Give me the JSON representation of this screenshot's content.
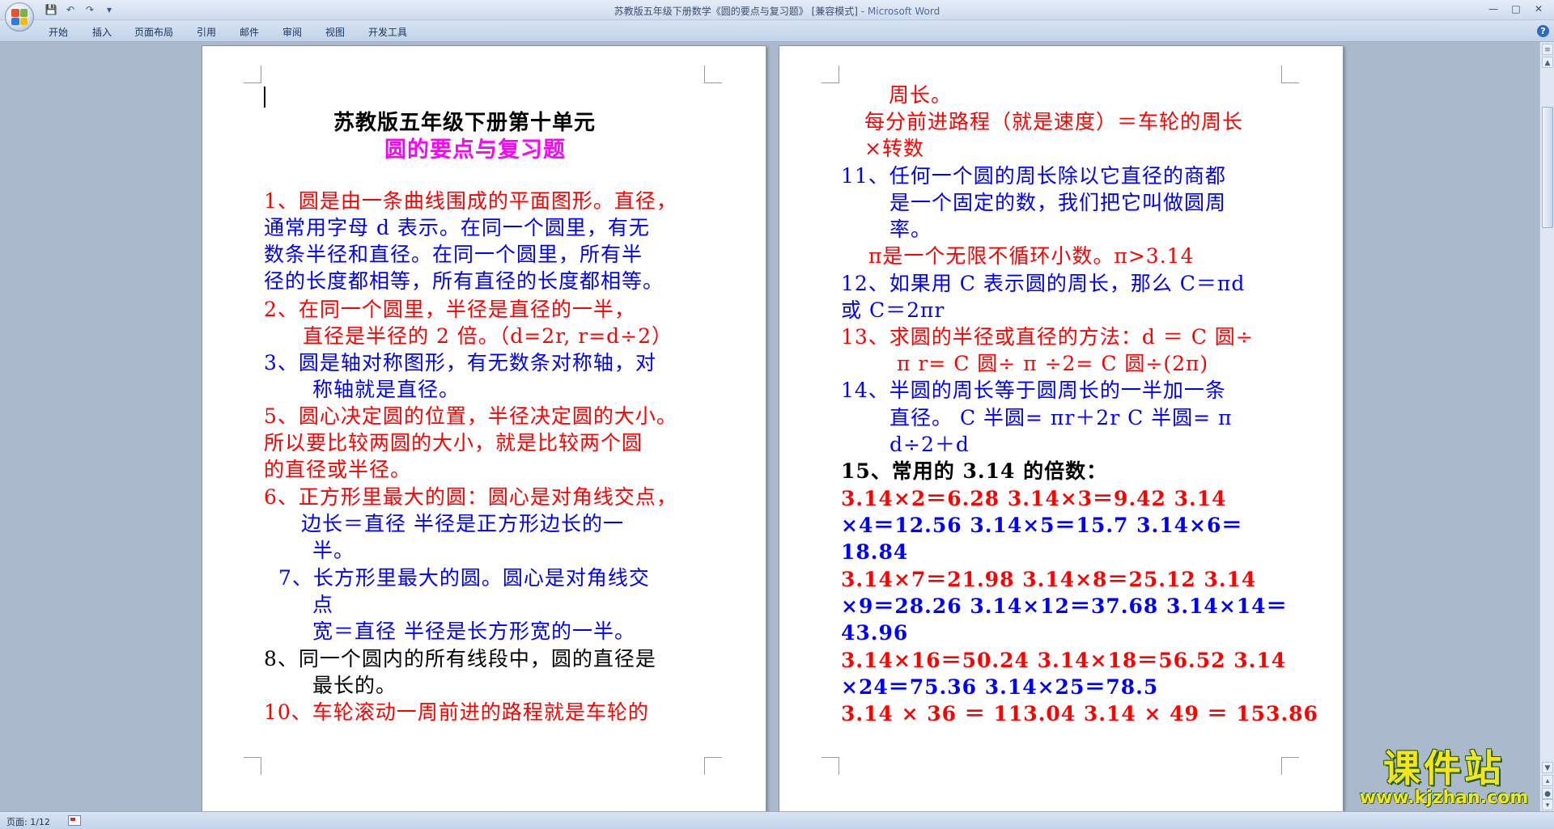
{
  "window": {
    "title": "苏教版五年级下册数学《圆的要点与复习题》 [兼容模式]",
    "app_name": " - Microsoft Word",
    "qat": [
      "💾",
      "↶",
      "↷",
      "▾"
    ],
    "controls": [
      "—",
      "□",
      "✕"
    ]
  },
  "ribbon": {
    "tabs": [
      "开始",
      "插入",
      "页面布局",
      "引用",
      "邮件",
      "审阅",
      "视图",
      "开发工具"
    ],
    "help": "?"
  },
  "status": {
    "page": "页面: 1/12"
  },
  "watermark": {
    "top": "课件站",
    "bottom": "www.kjzhan.com"
  },
  "left_page": [
    {
      "text": "苏教版五年级下册第十单元",
      "color": "black",
      "bold": true
    },
    {
      "text": "圆的要点与复习题",
      "color": "magenta",
      "bold": true
    },
    {
      "text": "1、圆是由一条曲线围成的平面图形。直径，",
      "color": "red"
    },
    {
      "text": "通常用字母 d 表示。在同一个圆里，有无",
      "color": "blue"
    },
    {
      "text": "数条半径和直径。在同一个圆里，所有半",
      "color": "blue"
    },
    {
      "text": "径的长度都相等，所有直径的长度都相等。",
      "color": "blue"
    },
    {
      "text": "2、在同一个圆里，半径是直径的一半，",
      "color": "red"
    },
    {
      "text": "直径是半径的 2 倍。（d=2r,    r=d÷2）",
      "color": "red"
    },
    {
      "text": "3、圆是轴对称图形，有无数条对称轴，对",
      "color": "blue"
    },
    {
      "text": "称轴就是直径。",
      "color": "blue"
    },
    {
      "text": "5、圆心决定圆的位置，半径决定圆的大小。",
      "color": "red"
    },
    {
      "text": "所以要比较两圆的大小，就是比较两个圆",
      "color": "red"
    },
    {
      "text": "的直径或半径。",
      "color": "red"
    },
    {
      "text": "6、正方形里最大的圆：圆心是对角线交点，",
      "color": "red"
    },
    {
      "text": "边长＝直径  半径是正方形边长的一",
      "color": "blue"
    },
    {
      "text": "半。",
      "color": "blue"
    },
    {
      "text": "7、长方形里最大的圆。圆心是对角线交",
      "color": "blue"
    },
    {
      "text": "点",
      "color": "blue"
    },
    {
      "text": "宽＝直径   半径是长方形宽的一半。",
      "color": "blue"
    },
    {
      "text": "8、同一个圆内的所有线段中，圆的直径是",
      "color": "black"
    },
    {
      "text": "最长的。",
      "color": "black"
    },
    {
      "text": "10、车轮滚动一周前进的路程就是车轮的",
      "color": "red"
    }
  ],
  "right_page": [
    {
      "text": "周长。",
      "color": "red"
    },
    {
      "text": "每分前进路程（就是速度）＝车轮的周长",
      "color": "red"
    },
    {
      "text": "×转数",
      "color": "red"
    },
    {
      "text": "11、任何一个圆的周长除以它直径的商都",
      "color": "blue"
    },
    {
      "text": "是一个固定的数，我们把它叫做圆周",
      "color": "blue"
    },
    {
      "text": "率。",
      "color": "blue"
    },
    {
      "text": "π是一个无限不循环小数。π>3.14",
      "color": "red"
    },
    {
      "text": "12、如果用 C 表示圆的周长，那么 C＝πd",
      "color": "blue"
    },
    {
      "text": "或 C＝2πr",
      "color": "blue"
    },
    {
      "text": "13、求圆的半径或直径的方法：d ＝ C 圆÷",
      "color": "red"
    },
    {
      "text": "π          r= C 圆÷  π ÷2= C 圆÷(2π)",
      "color": "red"
    },
    {
      "text": "14、半圆的周长等于圆周长的一半加一条",
      "color": "blue"
    },
    {
      "text": "直径。 C 半圆= πr＋2r       C 半圆= π",
      "color": "blue"
    },
    {
      "text": "d÷2＋d",
      "color": "blue"
    },
    {
      "text": "15、常用的 3.14 的倍数：",
      "color": "black"
    },
    {
      "text": "3.14×2＝6.28      3.14×3＝9.42      3.14",
      "color": "red",
      "bold": true
    },
    {
      "text": "×4＝12.56     3.14×5＝15.7     3.14×6＝",
      "color": "mixed",
      "bold": true
    },
    {
      "text": "18.84",
      "color": "blue",
      "bold": true
    },
    {
      "text": "3.14×7＝21.98      3.14×8＝25.12    3.14",
      "color": "red",
      "bold": true
    },
    {
      "text": "×9＝28.26    3.14×12＝37.68    3.14×14＝",
      "color": "mixed",
      "bold": true
    },
    {
      "text": "43.96",
      "color": "blue",
      "bold": true
    },
    {
      "text": "3.14×16＝50.24    3.14×18＝56.52    3.14",
      "color": "red",
      "bold": true
    },
    {
      "text": "×24＝75.36     3.14×25＝78.5",
      "color": "mixed",
      "bold": true
    },
    {
      "text": "3.14 × 36 ＝ 113.04    3.14 × 49 ＝ 153.86",
      "color": "red",
      "bold": true
    }
  ]
}
